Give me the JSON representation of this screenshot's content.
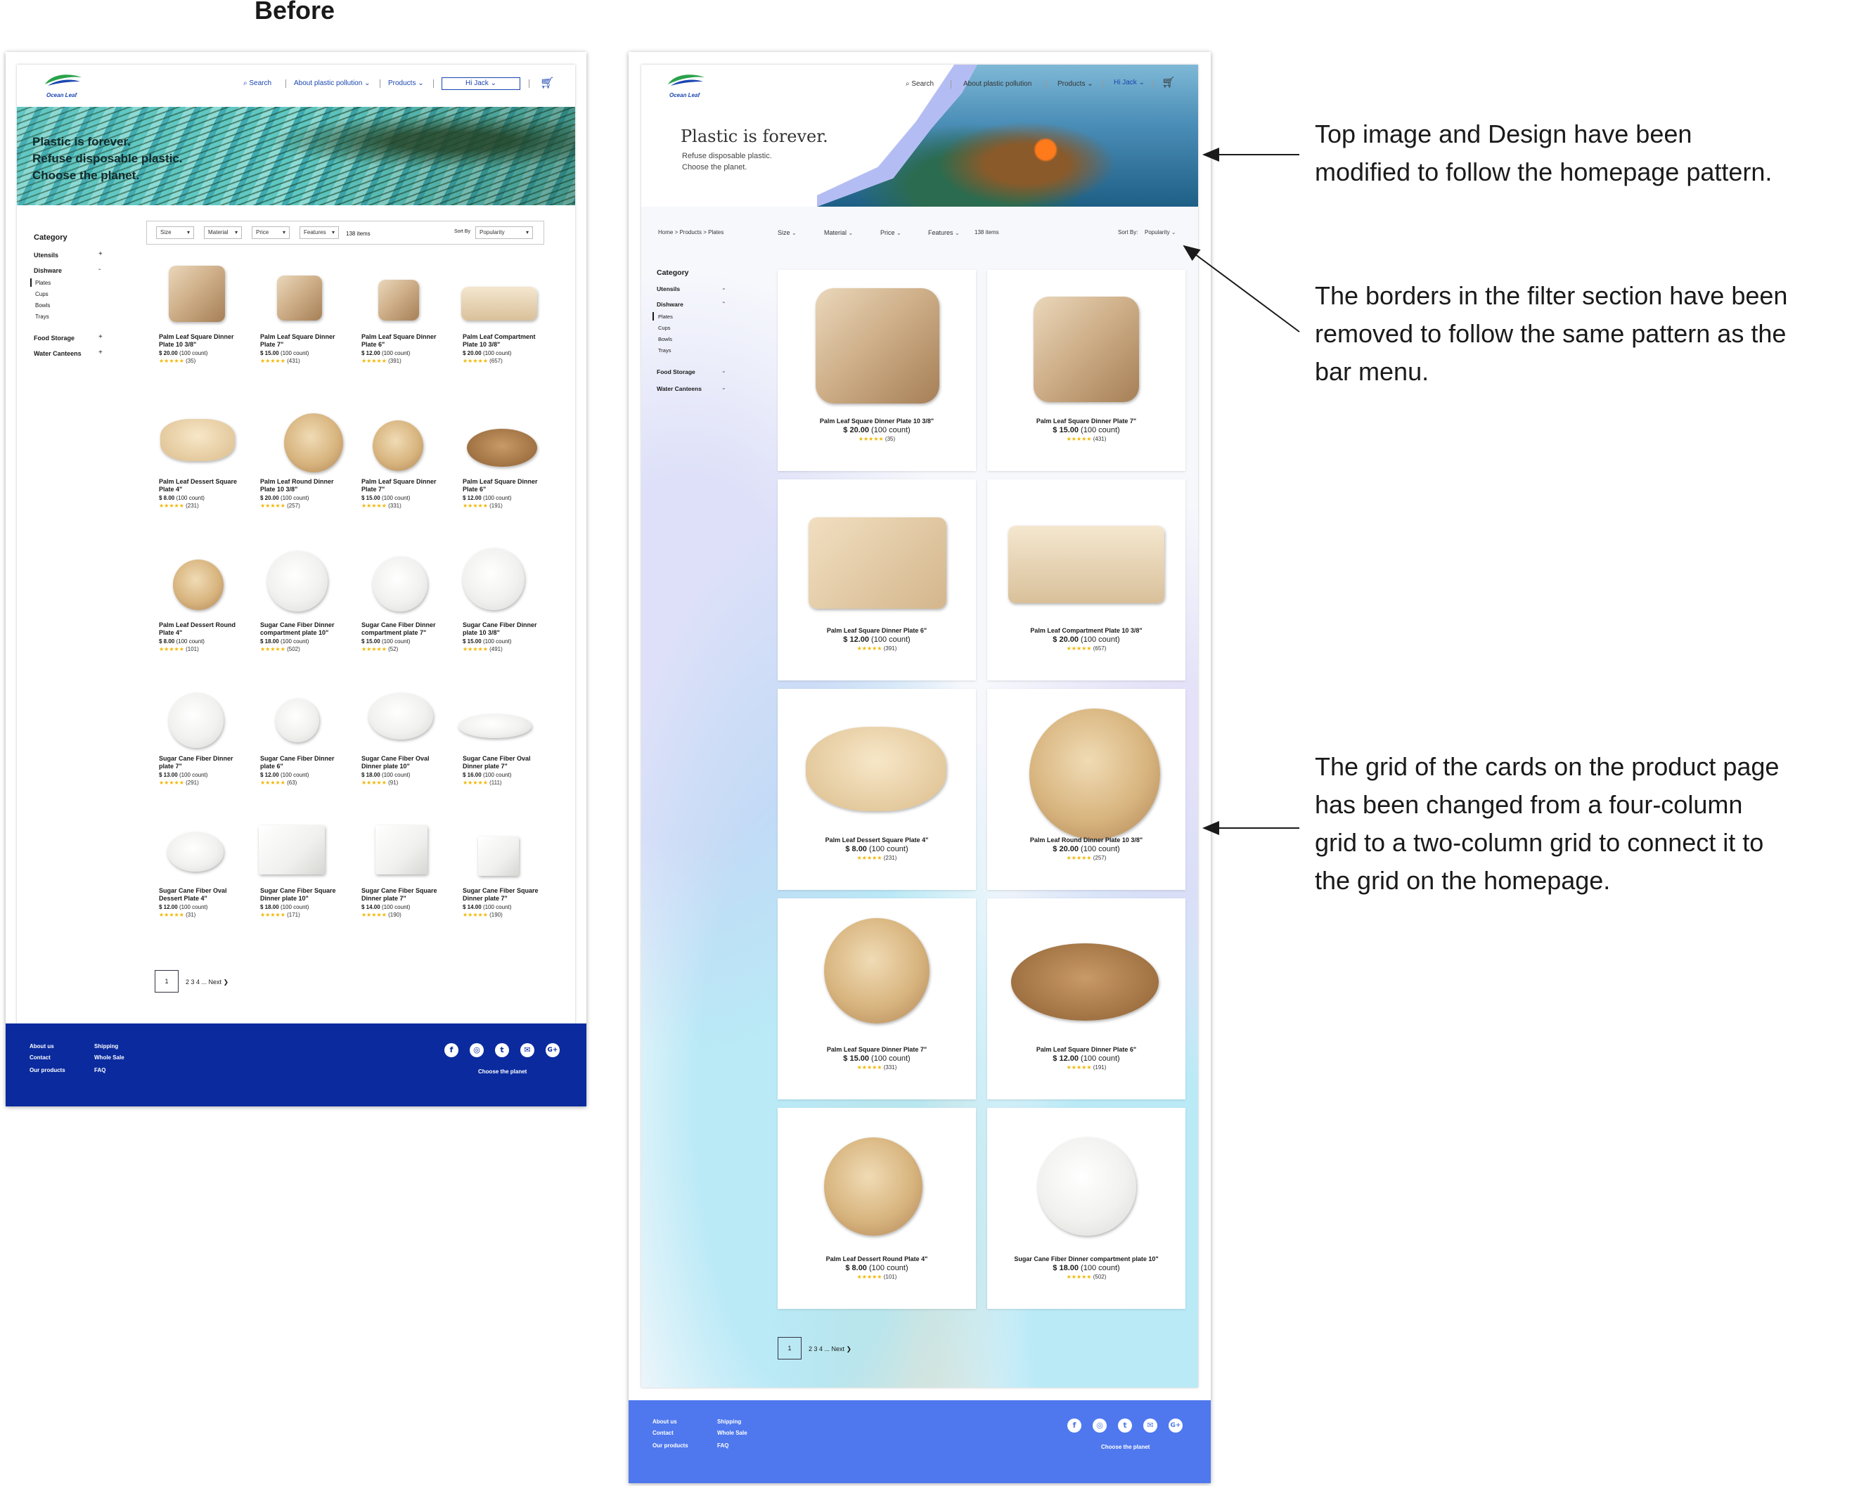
{
  "before_label": "Before",
  "brand": {
    "logo_text": "Ocean Leaf",
    "color_blue": "#0a2a9e",
    "color_after_blue": "#4f78ee",
    "accent_green": "#2aa24a"
  },
  "nav": {
    "search": "Search",
    "about": "About plastic pollution",
    "products": "Products",
    "user": "Hi Jack"
  },
  "before": {
    "hero": {
      "line1": "Plastic is forever.",
      "line2": "Refuse disposable plastic.",
      "line3": "Choose the planet."
    },
    "filters": {
      "size": "Size",
      "material": "Material",
      "price": "Price",
      "features": "Features",
      "count": "138 items",
      "sort_label": "Sort By",
      "sort_value": "Popularity"
    },
    "categories": {
      "title": "Category",
      "utensils": "Utensils",
      "dishware": "Dishware",
      "plates": "Plates",
      "cups": "Cups",
      "bowls": "Bowls",
      "trays": "Trays",
      "food_storage": "Food Storage",
      "water_canteens": "Water Canteens",
      "plus": "+",
      "minus": "-"
    },
    "products": [
      {
        "n1": "Palm Leaf Square Dinner",
        "n2": "Plate  10 3/8\"",
        "price": "$ 20.00",
        "count": "(100 count)",
        "stars": "★★★★★",
        "reviews": "(35)"
      },
      {
        "n1": "Palm Leaf Square Dinner",
        "n2": "Plate  7\"",
        "price": "$ 15.00",
        "count": "(100 count)",
        "stars": "★★★★★",
        "reviews": "(431)"
      },
      {
        "n1": "Palm Leaf Square Dinner",
        "n2": "Plate  6\"",
        "price": "$ 12.00",
        "count": "(100 count)",
        "stars": "★★★★★",
        "reviews": "(391)"
      },
      {
        "n1": "Palm Leaf Compartment",
        "n2": "Plate  10 3/8\"",
        "price": "$ 20.00",
        "count": "(100 count)",
        "stars": "★★★★★",
        "reviews": "(657)"
      },
      {
        "n1": "Palm Leaf Dessert Square",
        "n2": "Plate  4\"",
        "price": "$ 8.00",
        "count": "(100 count)",
        "stars": "★★★★★",
        "reviews": "(231)"
      },
      {
        "n1": "Palm Leaf Round Dinner",
        "n2": "Plate  10 3/8\"",
        "price": "$ 20.00",
        "count": "(100 count)",
        "stars": "★★★★★",
        "reviews": "(257)"
      },
      {
        "n1": "Palm Leaf Square Dinner",
        "n2": "Plate  7\"",
        "price": "$ 15.00",
        "count": "(100 count)",
        "stars": "★★★★★",
        "reviews": "(331)"
      },
      {
        "n1": "Palm Leaf Square Dinner",
        "n2": "Plate  6\"",
        "price": "$ 12.00",
        "count": "(100 count)",
        "stars": "★★★★★",
        "reviews": "(191)"
      },
      {
        "n1": "Palm Leaf Dessert Round",
        "n2": "Plate  4\"",
        "price": "$ 8.00",
        "count": "(100 count)",
        "stars": "★★★★★",
        "reviews": "(101)"
      },
      {
        "n1": "Sugar Cane Fiber Dinner",
        "n2": "compartment plate 10\"",
        "price": "$ 18.00",
        "count": "(100 count)",
        "stars": "★★★★★",
        "reviews": "(502)"
      },
      {
        "n1": "Sugar Cane Fiber Dinner",
        "n2": "compartment plate 7\"",
        "price": "$ 15.00",
        "count": "(100 count)",
        "stars": "★★★★★",
        "reviews": "(52)"
      },
      {
        "n1": "Sugar Cane Fiber Dinner",
        "n2": "plate 10 3/8\"",
        "price": "$ 15.00",
        "count": "(100 count)",
        "stars": "★★★★★",
        "reviews": "(491)"
      },
      {
        "n1": "Sugar Cane Fiber Dinner",
        "n2": "plate 7\"",
        "price": "$ 13.00",
        "count": "(100 count)",
        "stars": "★★★★★",
        "reviews": "(291)"
      },
      {
        "n1": "Sugar Cane Fiber Dinner",
        "n2": "plate 6\"",
        "price": "$ 12.00",
        "count": "(100 count)",
        "stars": "★★★★★",
        "reviews": "(63)"
      },
      {
        "n1": "Sugar Cane Fiber Oval",
        "n2": "Dinner plate 10\"",
        "price": "$ 18.00",
        "count": "(100 count)",
        "stars": "★★★★★",
        "reviews": "(91)"
      },
      {
        "n1": "Sugar Cane Fiber Oval",
        "n2": "Dinner plate 7\"",
        "price": "$ 16.00",
        "count": "(100 count)",
        "stars": "★★★★★",
        "reviews": "(111)"
      },
      {
        "n1": "Sugar Cane Fiber Oval",
        "n2": "Dessert Plate  4\"",
        "price": "$ 12.00",
        "count": "(100 count)",
        "stars": "★★★★★",
        "reviews": "(31)"
      },
      {
        "n1": "Sugar Cane Fiber Square",
        "n2": "Dinner plate 10\"",
        "price": "$ 18.00",
        "count": "(100 count)",
        "stars": "★★★★★",
        "reviews": "(171)"
      },
      {
        "n1": "Sugar Cane Fiber Square",
        "n2": "Dinner plate 7\"",
        "price": "$ 14.00",
        "count": "(100 count)",
        "stars": "★★★★★",
        "reviews": "(190)"
      },
      {
        "n1": "Sugar Cane Fiber Square",
        "n2": "Dinner plate 7\"",
        "price": "$ 14.00",
        "count": "(100 count)",
        "stars": "★★★★★",
        "reviews": "(190)"
      }
    ],
    "pagination": {
      "current": "1",
      "rest": "2  3  4  ...    Next  ❯"
    }
  },
  "after": {
    "hero": {
      "line1": "Plastic is forever.",
      "line2": "Refuse disposable plastic.",
      "line3": "Choose the planet."
    },
    "breadcrumb": "Home > Products > Plates",
    "filters": {
      "size": "Size",
      "material": "Material",
      "price": "Price",
      "features": "Features",
      "count": "138 items",
      "sort_label": "Sort By:",
      "sort_value": "Popularity"
    },
    "categories": {
      "title": "Category",
      "utensils": "Utensils",
      "dishware": "Dishware",
      "plates": "Plates",
      "cups": "Cups",
      "bowls": "Bowls",
      "trays": "Trays",
      "food_storage": "Food Storage",
      "water_canteens": "Water Canteens"
    },
    "products": [
      {
        "name": "Palm Leaf Square Dinner Plate  10 3/8\"",
        "price": "$ 20.00",
        "count": "(100 count)",
        "stars": "★★★★★",
        "reviews": "(35)"
      },
      {
        "name": "Palm Leaf Square Dinner Plate  7\"",
        "price": "$ 15.00",
        "count": "(100 count)",
        "stars": "★★★★★",
        "reviews": "(431)"
      },
      {
        "name": "Palm Leaf Square Dinner Plate  6\"",
        "price": "$ 12.00",
        "count": "(100 count)",
        "stars": "★★★★★",
        "reviews": "(391)"
      },
      {
        "name": "Palm Leaf Compartment Plate  10 3/8\"",
        "price": "$ 20.00",
        "count": "(100 count)",
        "stars": "★★★★★",
        "reviews": "(657)"
      },
      {
        "name": "Palm Leaf Dessert Square Plate  4\"",
        "price": "$ 8.00",
        "count": "(100 count)",
        "stars": "★★★★★",
        "reviews": "(231)"
      },
      {
        "name": "Palm Leaf Round Dinner Plate  10 3/8\"",
        "price": "$ 20.00",
        "count": "(100 count)",
        "stars": "★★★★★",
        "reviews": "(257)"
      },
      {
        "name": "Palm Leaf Square Dinner Plate  7\"",
        "price": "$ 15.00",
        "count": "(100 count)",
        "stars": "★★★★★",
        "reviews": "(331)"
      },
      {
        "name": "Palm Leaf Square Dinner Plate  6\"",
        "price": "$ 12.00",
        "count": "(100 count)",
        "stars": "★★★★★",
        "reviews": "(191)"
      },
      {
        "name": "Palm Leaf Dessert Round Plate  4\"",
        "price": "$ 8.00",
        "count": "(100 count)",
        "stars": "★★★★★",
        "reviews": "(101)"
      },
      {
        "name": "Sugar Cane Fiber Dinner compartment plate 10\"",
        "price": "$ 18.00",
        "count": "(100 count)",
        "stars": "★★★★★",
        "reviews": "(502)"
      }
    ],
    "pagination": {
      "current": "1",
      "rest": "2  3  4  ...    Next  ❯"
    }
  },
  "footer": {
    "about": "About us",
    "contact": "Contact",
    "our_products": "Our products",
    "shipping": "Shipping",
    "wholesale": "Whole Sale",
    "faq": "FAQ",
    "tagline": "Choose the planet"
  },
  "social_icons": [
    "facebook-icon",
    "instagram-icon",
    "twitter-icon",
    "mail-icon",
    "google-plus-icon"
  ],
  "annotations": {
    "a1": [
      "Top image and Design have been",
      "modified to follow the homepage pattern."
    ],
    "a2": [
      "The borders in the filter section have been",
      "removed to follow the same pattern as the",
      "bar menu."
    ],
    "a3": [
      "The grid of the cards on the product page",
      "has been changed from a four-column",
      "grid to a two-column grid to connect it to",
      "the grid on the homepage."
    ]
  }
}
